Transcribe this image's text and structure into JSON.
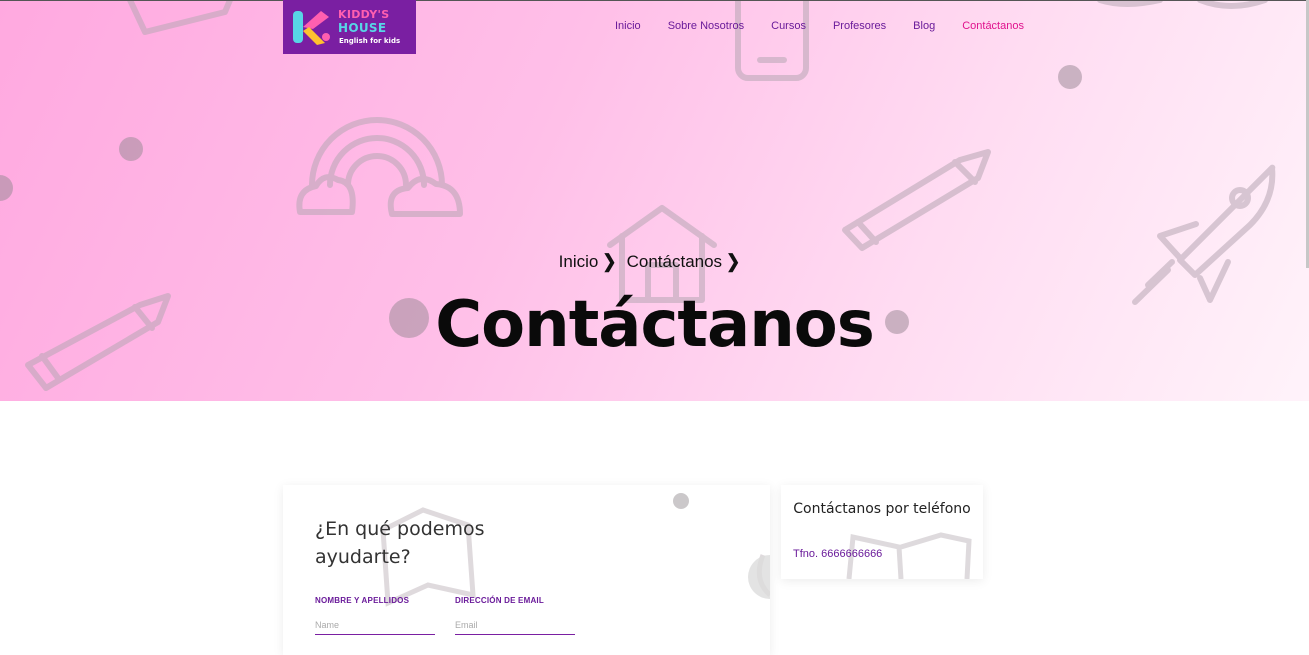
{
  "brand": {
    "logo_letter": "K",
    "logo_line1": "KIDDY'S",
    "logo_line2": "HOUSE",
    "logo_tagline": "English for kids"
  },
  "nav": {
    "items": [
      {
        "label": "Inicio"
      },
      {
        "label": "Sobre Nosotros"
      },
      {
        "label": "Cursos"
      },
      {
        "label": "Profesores"
      },
      {
        "label": "Blog"
      },
      {
        "label": "Contáctanos",
        "active": true
      }
    ]
  },
  "breadcrumb": {
    "items": [
      "Inicio",
      "Contáctanos"
    ],
    "separator": "❯"
  },
  "hero": {
    "title": "Contáctanos"
  },
  "form": {
    "heading": "¿En qué podemos ayudarte?",
    "fields": [
      {
        "label": "NOMBRE Y APELLIDOS",
        "placeholder": "Name",
        "value": ""
      },
      {
        "label": "DIRECCIÓN DE EMAIL",
        "placeholder": "Email",
        "value": ""
      }
    ]
  },
  "phone_card": {
    "title": "Contáctanos por teléfono",
    "phone": "Tfno. 6666666666"
  },
  "colors": {
    "brand_purple": "#6a1b9a",
    "active_pink": "#e0138e",
    "hero_gradient_start": "#ffa9e0",
    "hero_gradient_end": "#fff3fa"
  },
  "icons": [
    "chevron-right-icon",
    "rainbow-icon",
    "pencil-icon",
    "rocket-icon",
    "house-icon",
    "phone-icon",
    "book-icon"
  ]
}
